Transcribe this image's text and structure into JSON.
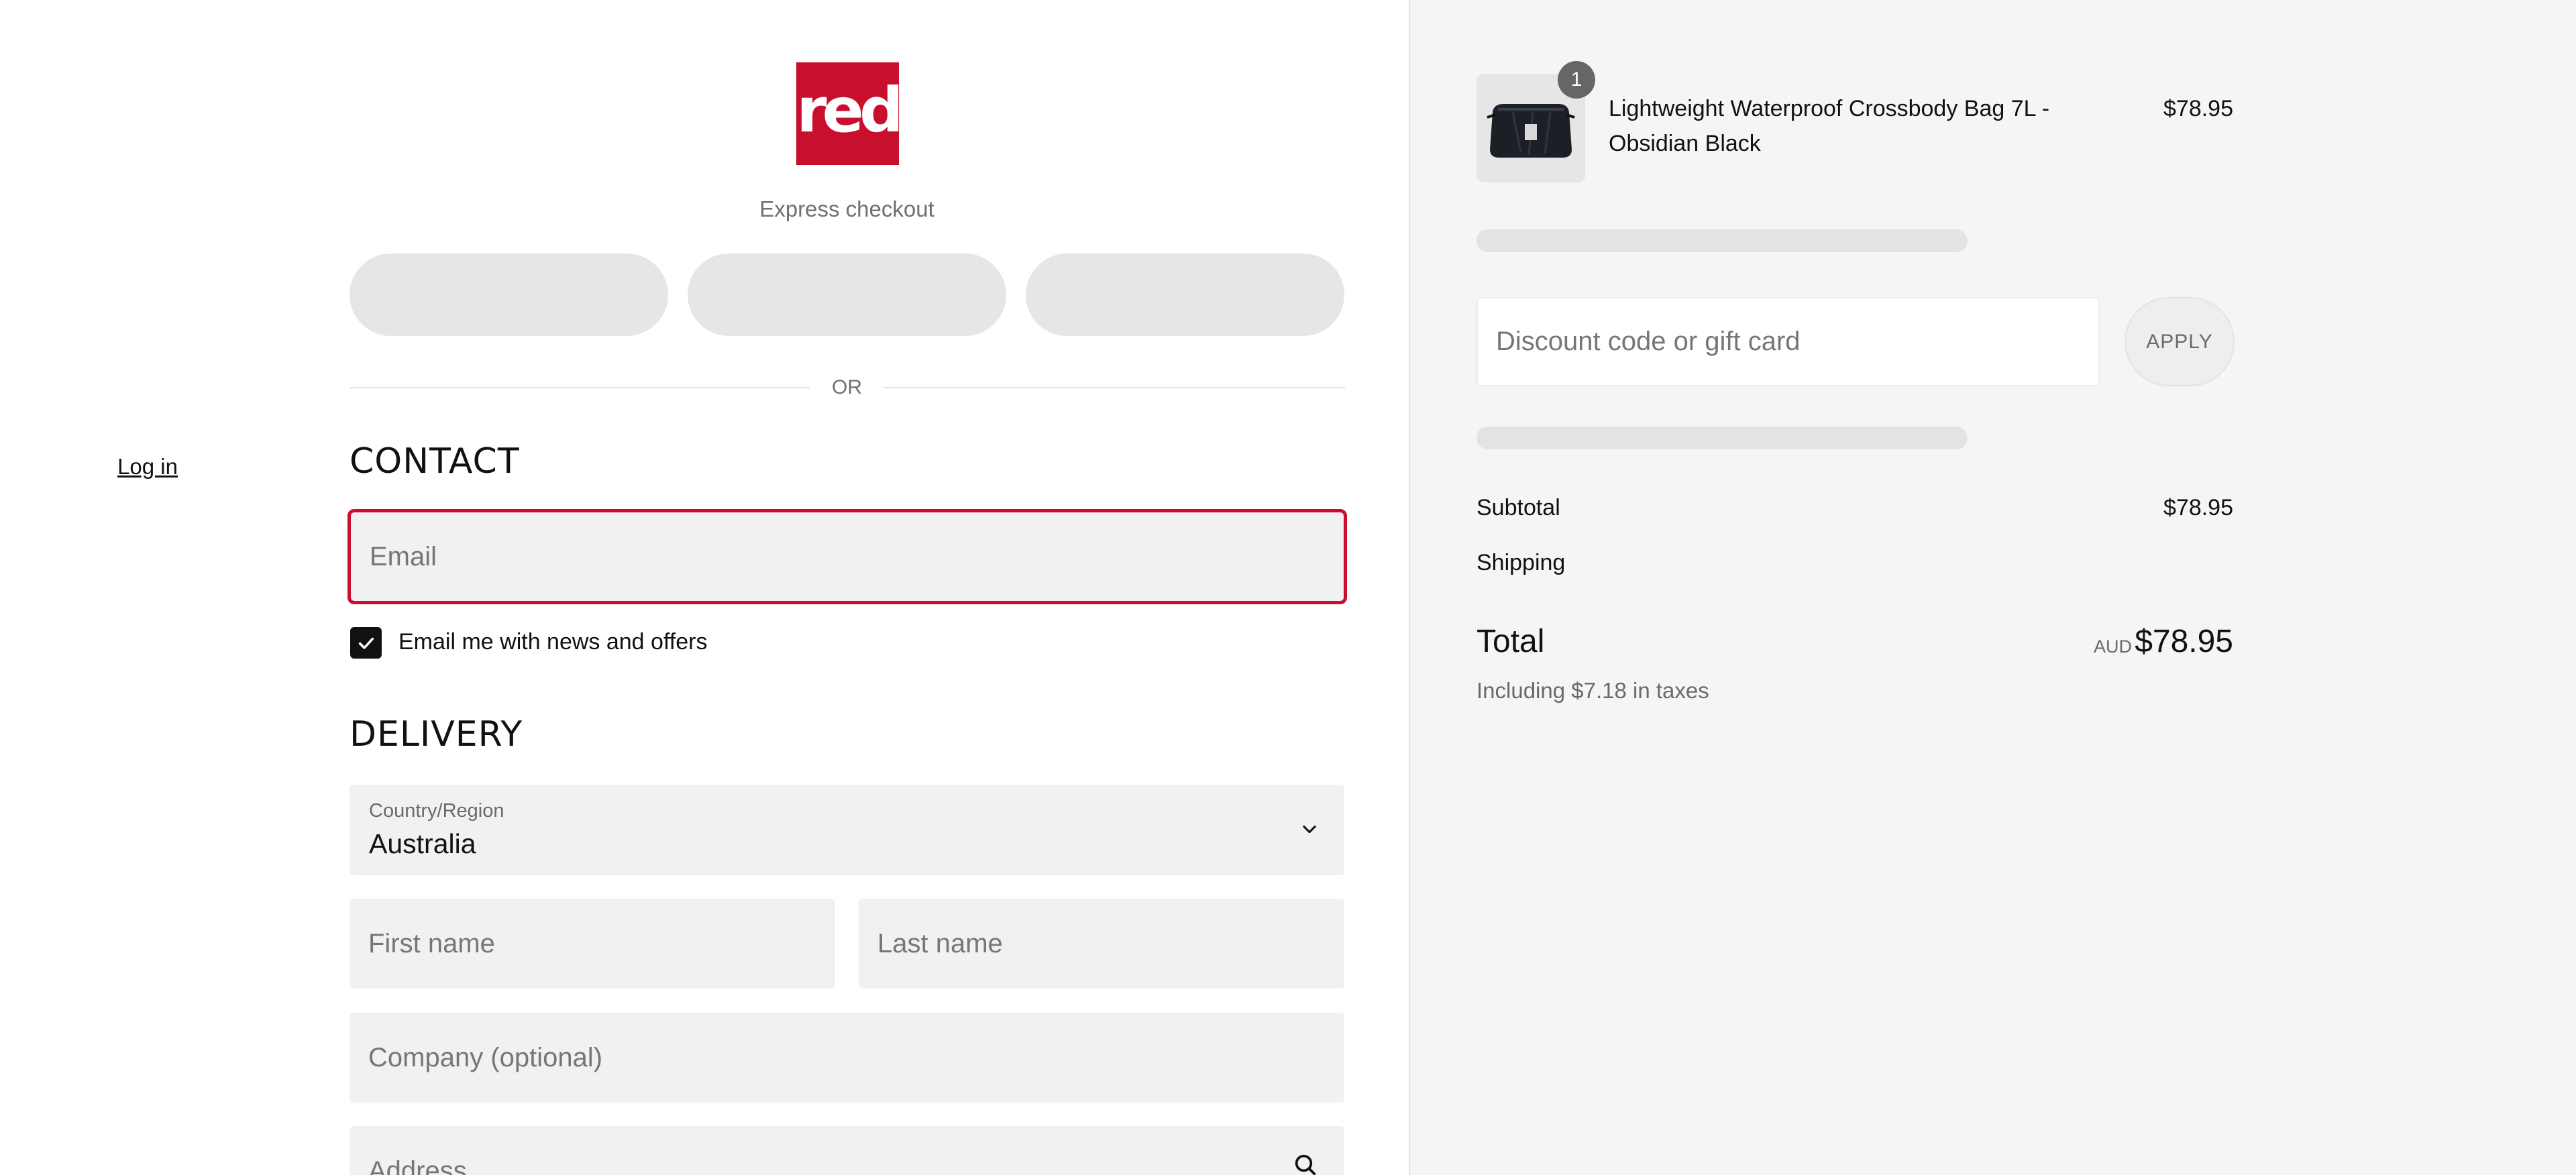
{
  "brand": {
    "logo_text": "red",
    "logo_color": "#c8102e"
  },
  "express": {
    "label": "Express checkout",
    "or_label": "OR"
  },
  "contact": {
    "title": "CONTACT",
    "login_label": "Log in",
    "email_placeholder": "Email",
    "newsletter_label": "Email me with news and offers",
    "newsletter_checked": true
  },
  "delivery": {
    "title": "DELIVERY",
    "country_label": "Country/Region",
    "country_value": "Australia",
    "first_name_placeholder": "First name",
    "last_name_placeholder": "Last name",
    "company_placeholder": "Company (optional)",
    "address_placeholder": "Address"
  },
  "summary": {
    "item": {
      "name": "Lightweight Waterproof Crossbody Bag 7L - Obsidian Black",
      "price": "$78.95",
      "quantity": "1"
    },
    "discount_placeholder": "Discount code or gift card",
    "apply_label": "APPLY",
    "subtotal_label": "Subtotal",
    "subtotal_value": "$78.95",
    "shipping_label": "Shipping",
    "total_label": "Total",
    "currency": "AUD",
    "total_value": "$78.95",
    "tax_note": "Including $7.18 in taxes"
  },
  "colors": {
    "accent": "#c8102e",
    "sidebar_bg": "#f5f5f5",
    "field_bg": "#f1f1f1"
  }
}
